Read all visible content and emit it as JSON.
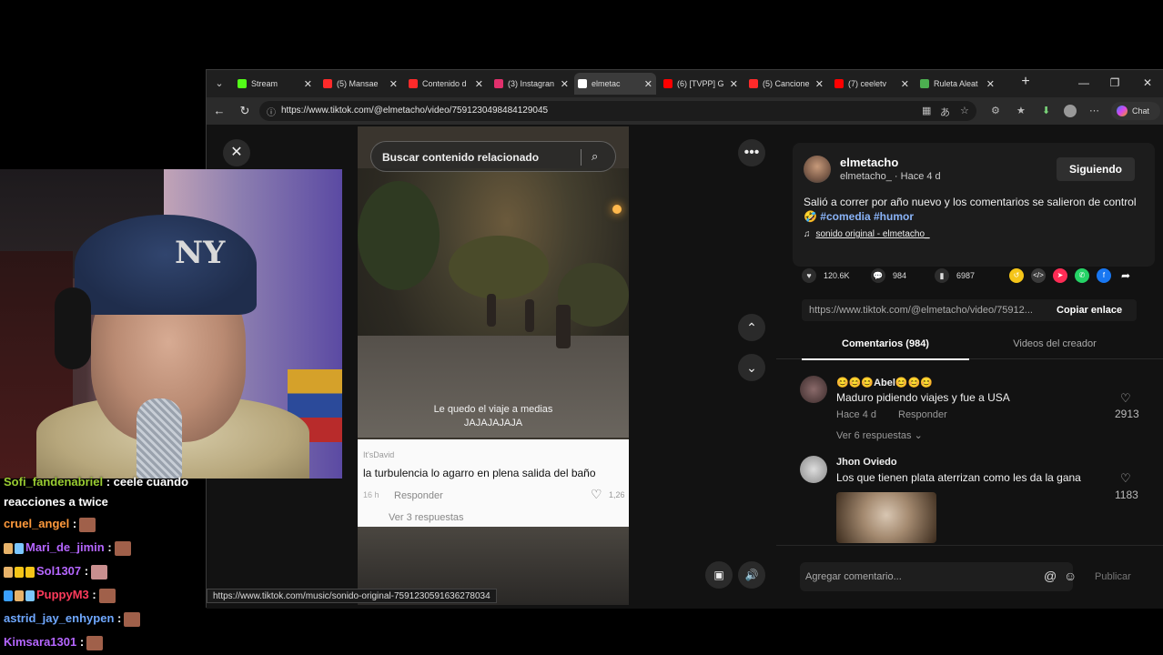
{
  "browser": {
    "tabs": [
      {
        "label": "Stream",
        "favicon_color": "#53fc18",
        "active": false
      },
      {
        "label": "(5) Mansae",
        "favicon_color": "#ff2a2a",
        "active": false
      },
      {
        "label": "Contenido d",
        "favicon_color": "#ff2a2a",
        "active": false
      },
      {
        "label": "(3) Instagran",
        "favicon_color": "#e1306c",
        "active": false
      },
      {
        "label": "elmetac",
        "favicon_color": "#ffffff",
        "active": true
      },
      {
        "label": "(6) [TVPP] G",
        "favicon_color": "#ff0000",
        "active": false
      },
      {
        "label": "(5) Cancione",
        "favicon_color": "#ff2a2a",
        "active": false
      },
      {
        "label": "(7) ceeletv",
        "favicon_color": "#ff0000",
        "active": false
      },
      {
        "label": "Ruleta Aleat",
        "favicon_color": "#4caf50",
        "active": false
      }
    ],
    "url": "https://www.tiktok.com/@elmetacho/video/7591230498484129045",
    "chat_label": "Chat",
    "status_url": "https://www.tiktok.com/music/sonido-original-7591230591636278034"
  },
  "video": {
    "search_placeholder": "Buscar contenido relacionado",
    "caption_line1": "Le quedo el viaje a medias",
    "caption_line2": "JAJAJAJAJA",
    "overlay_comment": {
      "user": "It'sDavid",
      "text": "la turbulencia lo agarro en plena salida del baño",
      "time": "16 h",
      "reply": "Responder",
      "likes": "1,26",
      "more": "Ver 3 respuestas"
    }
  },
  "post": {
    "author": "elmetacho",
    "author_sub": "elmetacho_ · Hace 4 d",
    "follow_label": "Siguiendo",
    "desc_text": "Salió a correr por año nuevo y los comentarios se salieron de control 🤣",
    "tags": [
      "#comedia",
      "#humor"
    ],
    "sound": "sonido original - elmetacho_",
    "likes": "120.6K",
    "comments": "984",
    "saves": "6987",
    "share_link": "https://www.tiktok.com/@elmetacho/video/75912...",
    "copy_label": "Copiar enlace",
    "share_colors": [
      "#f5c518",
      "#3a3a3a",
      "#fe2c55",
      "#25d366",
      "#1877f2"
    ]
  },
  "comments_section": {
    "tab_comments": "Comentarios (984)",
    "tab_creator": "Videos del creador",
    "items": [
      {
        "name": "😊😊😊Abel😊😊😊",
        "text": "Maduro pidiendo viajes y fue a USA",
        "time": "Hace 4 d",
        "reply": "Responder",
        "likes": "2913",
        "more": "Ver 6 respuestas ⌄"
      },
      {
        "name": "Jhon Oviedo",
        "text": "Los que tienen plata aterrizan como les da la gana",
        "likes": "1183"
      }
    ],
    "input_placeholder": "Agregar comentario...",
    "publish_label": "Publicar"
  },
  "stream_chat": [
    {
      "user": "Sofi_fandenabriel",
      "color": "#9acd32",
      "message": "ceele cuando",
      "cont": "reacciones a twice"
    },
    {
      "user": "cruel_angel",
      "color": "#ff9a3c"
    },
    {
      "user": "Mari_de_jimin",
      "color": "#b566ff"
    },
    {
      "user": "Sol1307",
      "color": "#b566ff"
    },
    {
      "user": "PuppyM3",
      "color": "#ff3b5c"
    },
    {
      "user": "astrid_jay_enhypen",
      "color": "#6fa8ff"
    },
    {
      "user": "Kimsara1301",
      "color": "#b566ff"
    }
  ]
}
